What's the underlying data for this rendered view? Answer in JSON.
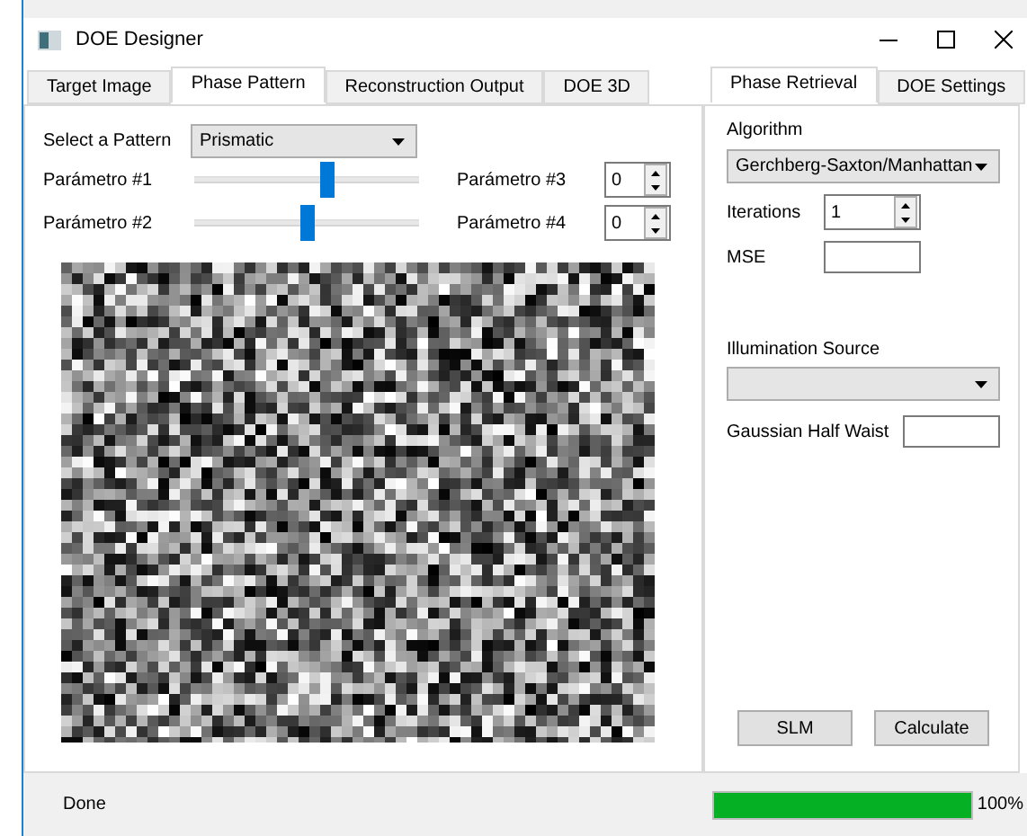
{
  "window": {
    "title": "DOE Designer"
  },
  "tabs": [
    {
      "label": "Target Image",
      "selected": false
    },
    {
      "label": "Phase Pattern",
      "selected": true
    },
    {
      "label": "Reconstruction Output",
      "selected": false
    },
    {
      "label": "DOE 3D",
      "selected": false
    }
  ],
  "pattern": {
    "label": "Select a Pattern",
    "value": "Prismatic"
  },
  "sliders": [
    {
      "label": "Parámetro #1",
      "level": 0.59
    },
    {
      "label": "Parámetro #2",
      "level": 0.5
    }
  ],
  "spinners": [
    {
      "label": "Parámetro #3",
      "value": "0"
    },
    {
      "label": "Parámetro #4",
      "value": "0"
    }
  ],
  "side_tabs": [
    {
      "label": "Phase Retrieval",
      "selected": true
    },
    {
      "label": "DOE Settings",
      "selected": false
    }
  ],
  "algorithm": {
    "label": "Algorithm",
    "value": "Gerchberg-Saxton/Manhattan"
  },
  "iterations": {
    "label": "Iterations",
    "value": "1"
  },
  "mse": {
    "label": "MSE"
  },
  "illumination": {
    "label": "Illumination Source"
  },
  "gaussian": {
    "label": "Gaussian Half Waist"
  },
  "buttons": [
    "SLM",
    "Calculate"
  ],
  "status_bar": {
    "text": "Done",
    "progress": {
      "level": 1,
      "reading": "100%"
    }
  }
}
